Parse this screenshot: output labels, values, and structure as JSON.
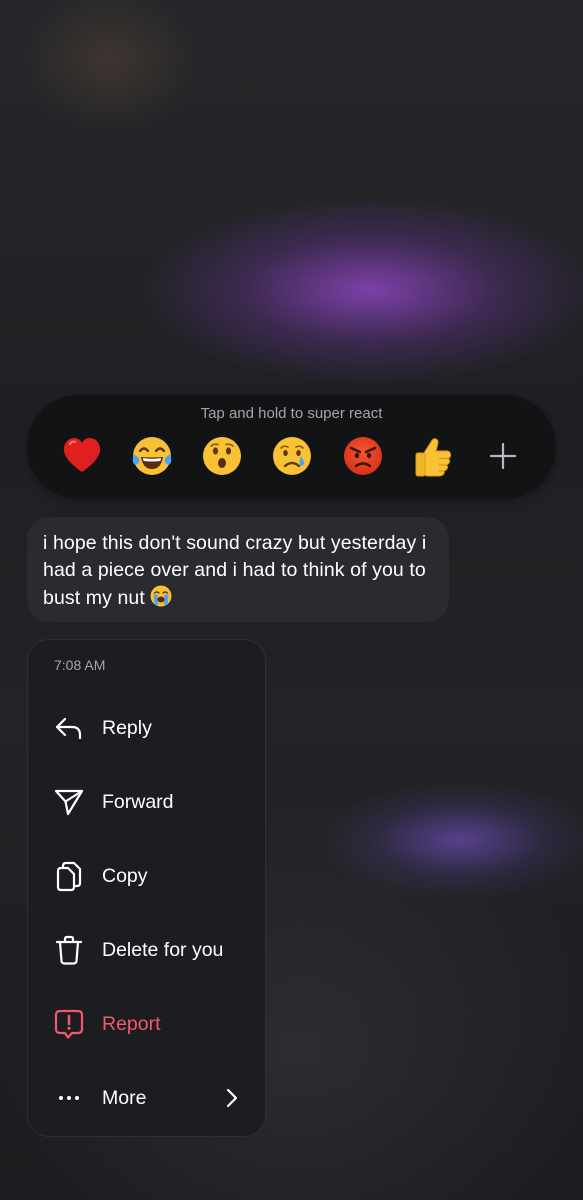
{
  "reaction_bar": {
    "hint": "Tap and hold to super react",
    "reactions": [
      {
        "icon": "red-heart-emoji"
      },
      {
        "icon": "tears-of-joy-emoji"
      },
      {
        "icon": "surprised-face-emoji"
      },
      {
        "icon": "crying-face-emoji"
      },
      {
        "icon": "angry-face-emoji"
      },
      {
        "icon": "thumbs-up-emoji"
      },
      {
        "icon": "plus-icon"
      }
    ]
  },
  "message": {
    "text": "i hope this don't sound crazy but yesterday i had a piece over and i had to think of you to bust my nut",
    "trailing_emoji": "loudly-crying-face-emoji"
  },
  "context_menu": {
    "timestamp": "7:08 AM",
    "items": [
      {
        "label": "Reply",
        "icon": "reply-arrow-icon"
      },
      {
        "label": "Forward",
        "icon": "paper-plane-icon"
      },
      {
        "label": "Copy",
        "icon": "copy-icon"
      },
      {
        "label": "Delete for you",
        "icon": "trash-icon"
      },
      {
        "label": "Report",
        "icon": "report-icon",
        "color": "#f2596c"
      },
      {
        "label": "More",
        "icon": "more-dots-icon"
      }
    ]
  },
  "colors": {
    "background": "#1b1c1e",
    "reaction_bar_bg": "#121315",
    "bubble_bg": "#2a2b2e",
    "menu_bg": "#1c1d20",
    "danger": "#f2596c",
    "muted_text": "#a4a6ab"
  }
}
